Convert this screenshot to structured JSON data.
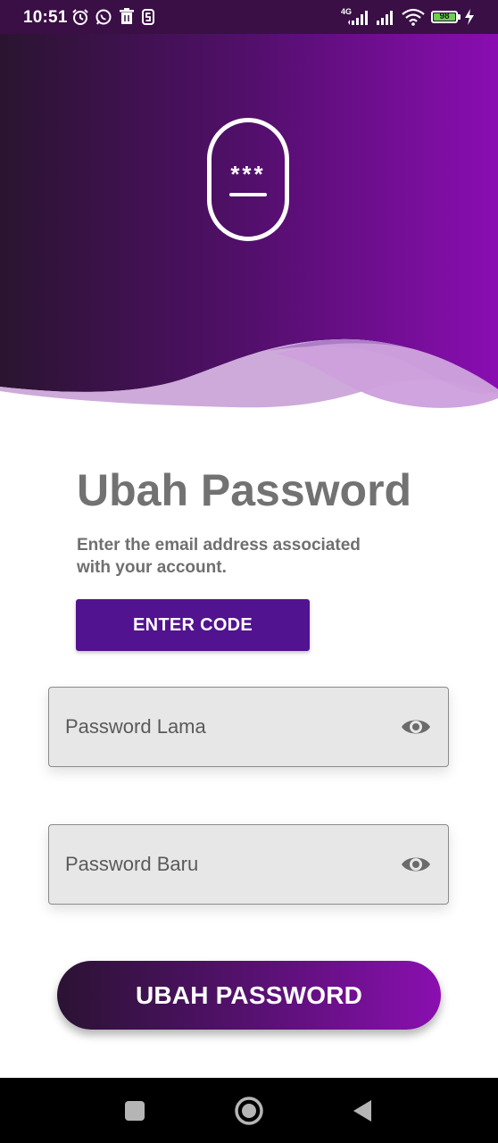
{
  "status_bar": {
    "time": "10:51",
    "network": "4G",
    "battery_level": "98",
    "battery_percent": 98,
    "icons": [
      "alarm-icon",
      "whatsapp-icon",
      "trash-icon",
      "s-app-icon",
      "signal-icon",
      "signal-icon",
      "wifi-icon",
      "battery-icon",
      "charging-icon"
    ]
  },
  "header": {
    "logo_text": "***"
  },
  "content": {
    "title": "Ubah Password",
    "subtitle": "Enter the email address associated with your account.",
    "enter_code_label": "ENTER CODE"
  },
  "form": {
    "old_password_placeholder": "Password Lama",
    "new_password_placeholder": "Password Baru",
    "submit_label": "UBAH PASSWORD"
  },
  "colors": {
    "accent": "#521390",
    "gradient_start": "#2b1233",
    "gradient_end": "#8a0fb0",
    "title": "#727272"
  },
  "nav_bar": {
    "icons": [
      "recents-icon",
      "home-icon",
      "back-icon"
    ]
  }
}
